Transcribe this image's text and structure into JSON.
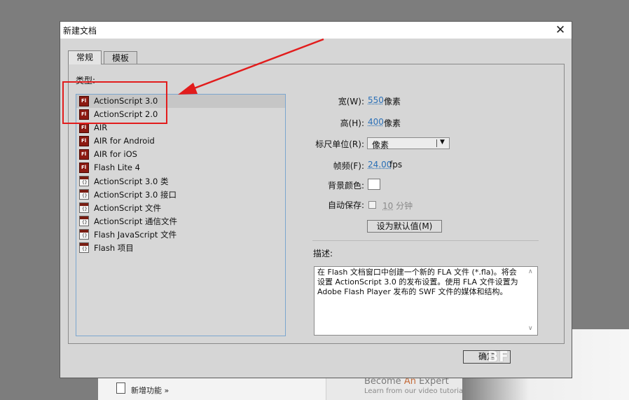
{
  "dialog": {
    "title": "新建文档",
    "close_glyph": "✕",
    "tabs": [
      {
        "label": "常规",
        "active": true
      },
      {
        "label": "模板",
        "active": false
      }
    ],
    "category_label": "类型:",
    "types": [
      {
        "label": "ActionScript 3.0",
        "icon": "flash-fla-icon",
        "selected": true
      },
      {
        "label": "ActionScript 2.0",
        "icon": "flash-fla-icon"
      },
      {
        "label": "AIR",
        "icon": "flash-fla-icon"
      },
      {
        "label": "AIR for Android",
        "icon": "flash-fla-icon"
      },
      {
        "label": "AIR for iOS",
        "icon": "flash-fla-icon"
      },
      {
        "label": "Flash Lite 4",
        "icon": "flash-fla-icon"
      },
      {
        "label": "ActionScript 3.0 类",
        "icon": "script-doc-icon"
      },
      {
        "label": "ActionScript 3.0 接口",
        "icon": "script-doc-icon"
      },
      {
        "label": "ActionScript 文件",
        "icon": "script-doc-icon"
      },
      {
        "label": "ActionScript 通信文件",
        "icon": "script-doc-icon"
      },
      {
        "label": "Flash JavaScript 文件",
        "icon": "script-doc-icon"
      },
      {
        "label": "Flash 项目",
        "icon": "project-doc-icon"
      }
    ],
    "settings": {
      "width_label": "宽(W):",
      "width_value": "550",
      "width_unit": "像素",
      "height_label": "高(H):",
      "height_value": "400",
      "height_unit": "像素",
      "ruler_label": "标尺单位(R):",
      "ruler_value": "像素",
      "ruler_arrow": "▼",
      "fps_label": "帧频(F):",
      "fps_value": "24.00",
      "fps_unit": "fps",
      "bgcolor_label": "背景颜色:",
      "bgcolor_value": "#ffffff",
      "autosave_label": "自动保存:",
      "autosave_minutes": "10",
      "autosave_unit": "分钟",
      "set_default_label": "设为默认值(M)"
    },
    "description_label": "描述:",
    "description_text": "在 Flash 文档窗口中创建一个新的 FLA 文件 (*.fla)。将会设置 ActionScript 3.0 的发布设置。使用 FLA 文件设置为 Adobe Flash Player 发布的 SWF 文件的媒体和结构。",
    "ok_label": "确定"
  },
  "background_app": {
    "new_features": "新增功能 »",
    "become_prefix": "Become ",
    "become_an": "An",
    "become_suffix": " Expert",
    "learn_text": "Learn from our video tutoria"
  },
  "watermark": "BF",
  "annotation": {
    "color": "#e21c1c"
  },
  "colors": {
    "link_value": "#2a6fb6",
    "flash_icon": "#8c1a12",
    "selection": "#c6c6c6"
  }
}
